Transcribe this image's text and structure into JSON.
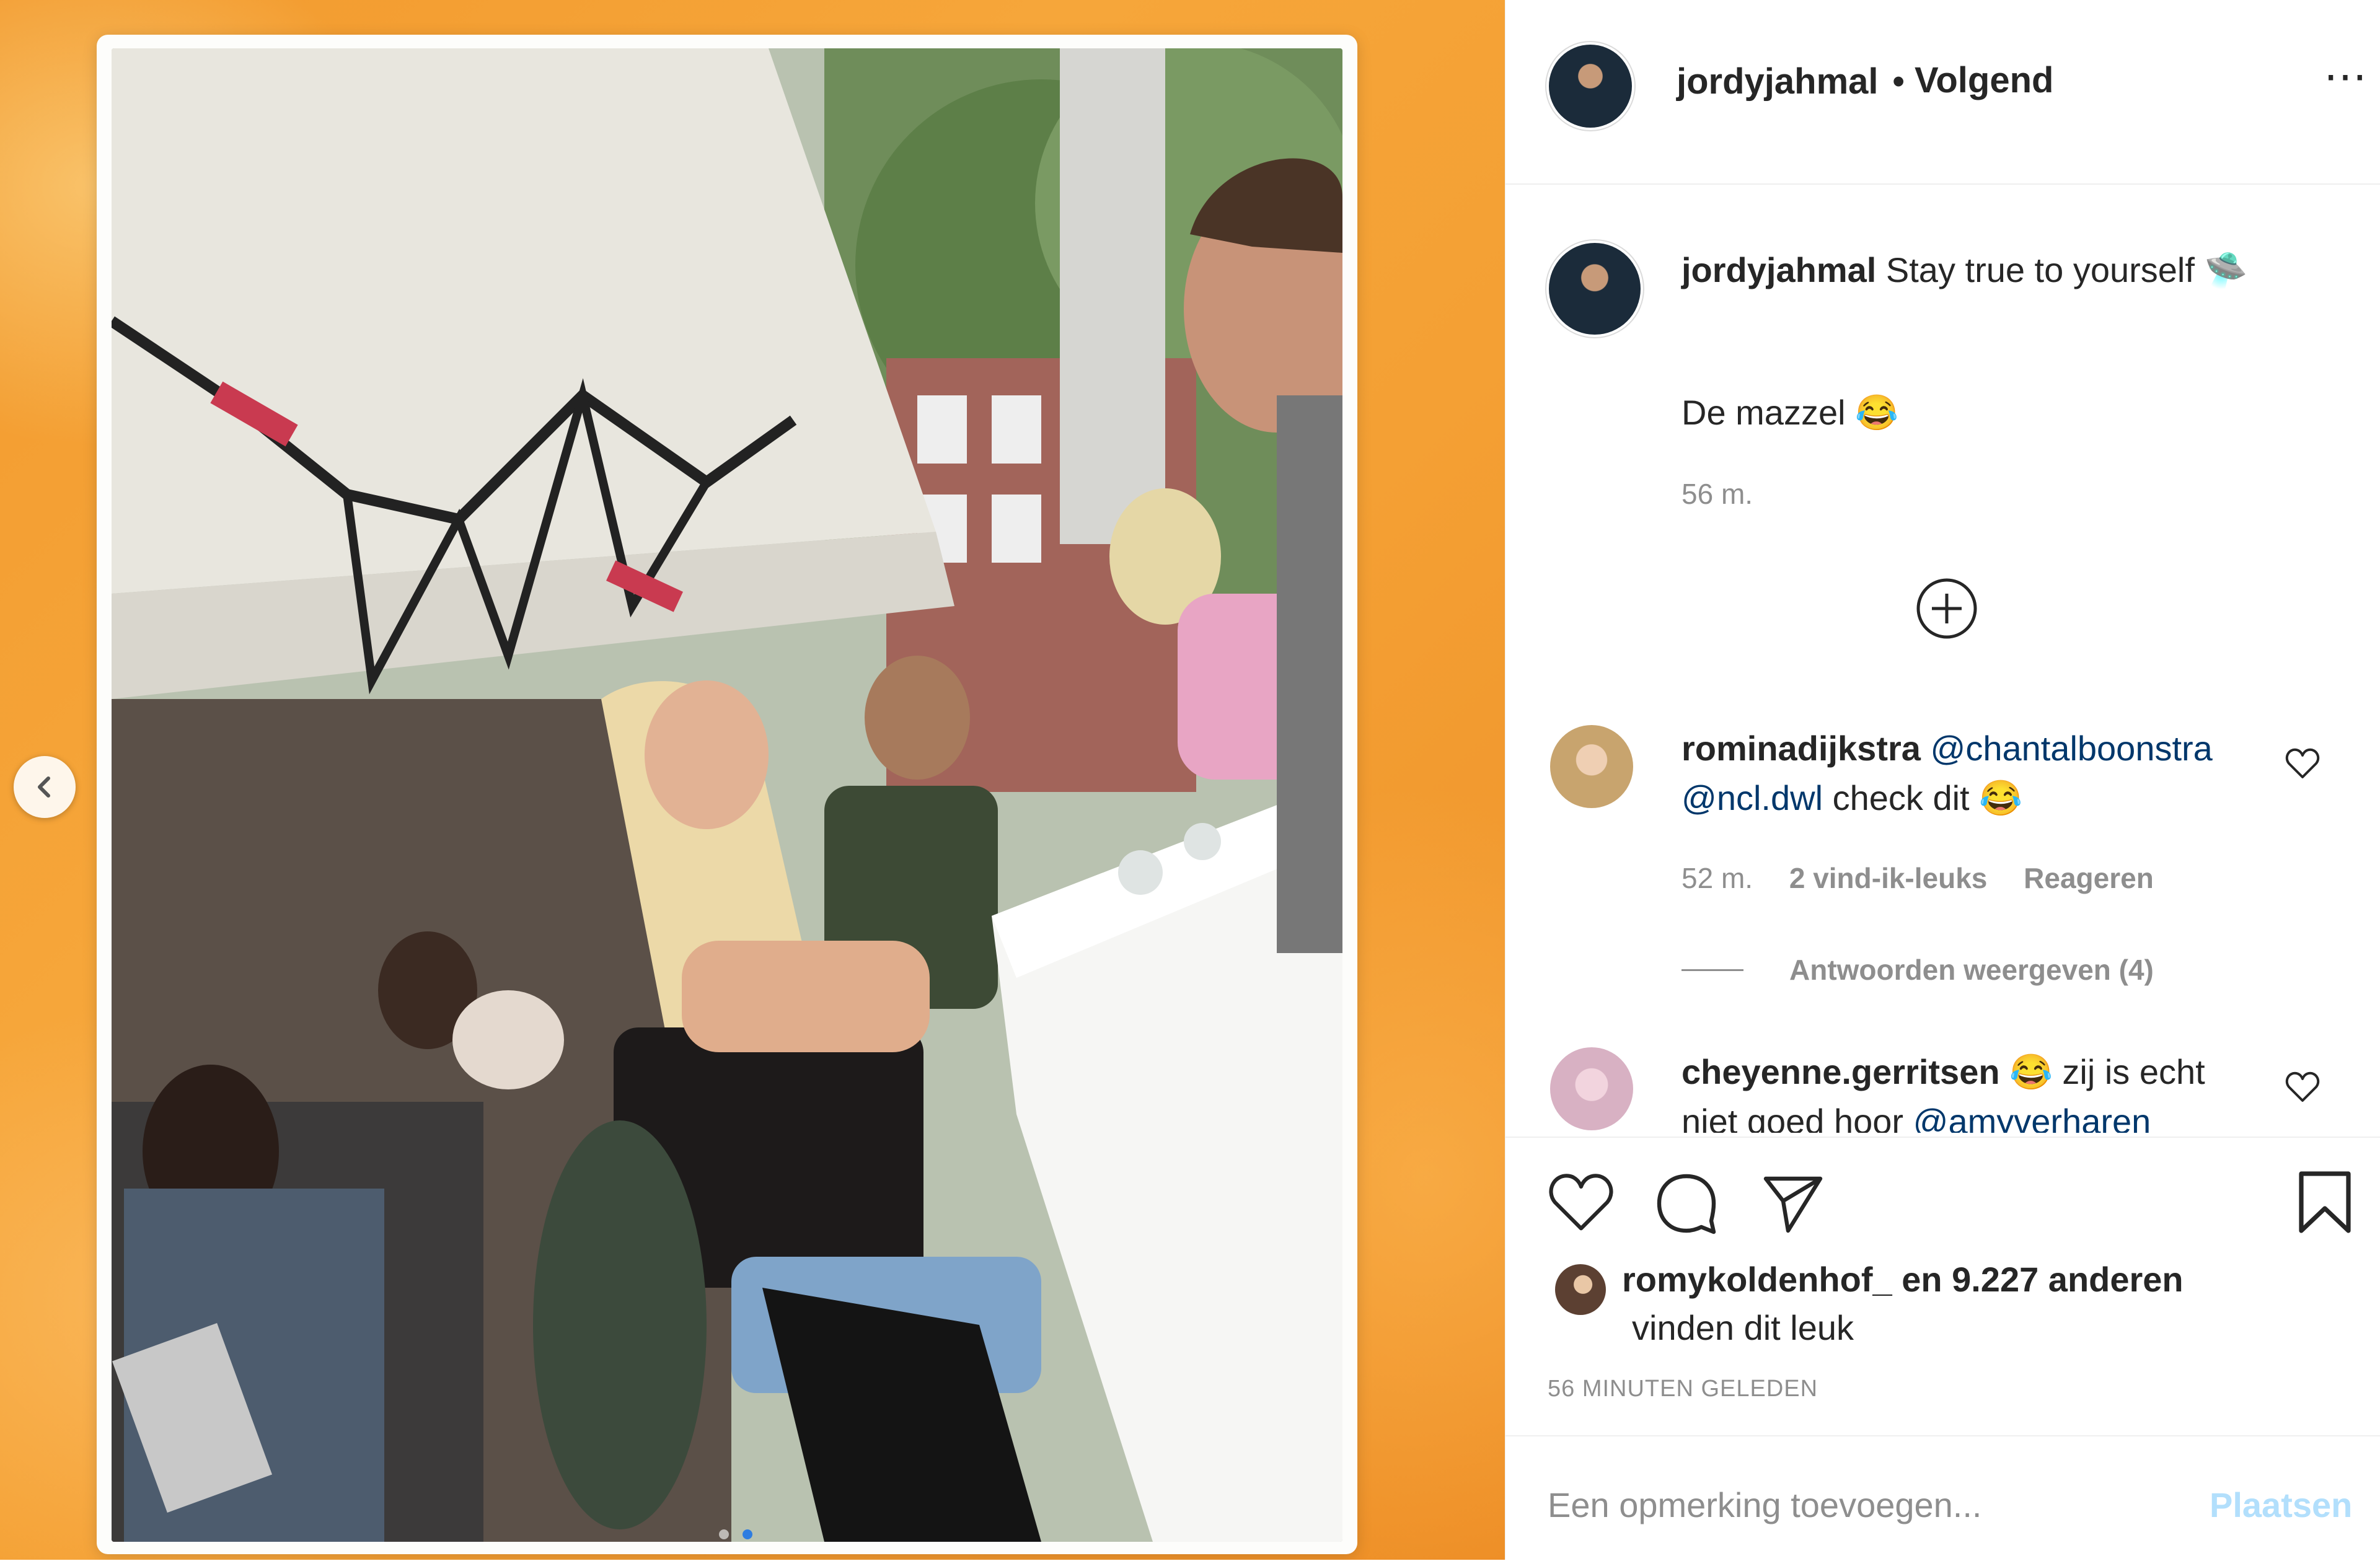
{
  "post": {
    "username": "jordyjahmal",
    "separator": "•",
    "follow_status": "Volgend",
    "more_icon": "⋯",
    "caption_text": "Stay true to yourself",
    "caption_emoji": "🛸",
    "caption_line2": "De mazzel",
    "caption_emoji2": "😂",
    "caption_time": "56 m.",
    "load_more_icon": "plus-circle-icon"
  },
  "comments": [
    {
      "username": "rominadijkstra",
      "mention1": "@chantalboonstra",
      "mention2": "@ncl.dwl",
      "text": "check dit",
      "emoji": "😂",
      "time": "52 m.",
      "likes": "2 vind-ik-leuks",
      "reply": "Reageren",
      "view_replies": "Antwoorden weergeven (4)"
    },
    {
      "username": "cheyenne.gerritsen",
      "emoji": "😂",
      "text": "zij is echt",
      "text2": "niet goed hoor",
      "mention": "@amyverharen"
    }
  ],
  "likes": {
    "first_liker": "romykoldenhof_",
    "rest": "en 9.227 anderen",
    "suffix": "vinden dit leuk"
  },
  "posted_ago": "56 MINUTEN GELEDEN",
  "add_comment": {
    "placeholder": "Een opmerking toevoegen...",
    "post_label": "Plaatsen"
  },
  "colors": {
    "background_orange": "#f4a034",
    "link_blue": "#00376b",
    "post_button_disabled": "#b2dffc",
    "muted_text": "#8e8e8e"
  }
}
